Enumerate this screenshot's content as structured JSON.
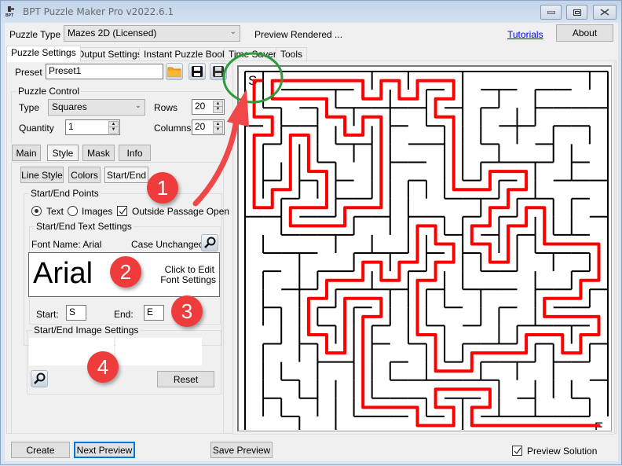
{
  "window": {
    "title": "BPT Puzzle Maker Pro v2022.6.1",
    "app_icon_text": "BPT",
    "controls": [
      "minimize",
      "maximize",
      "close"
    ]
  },
  "toolbar": {
    "puzzle_type_label": "Puzzle Type",
    "puzzle_type_value": "Mazes 2D (Licensed)",
    "status": "Preview Rendered ...",
    "tutorials_link": "Tutorials",
    "about_label": "About"
  },
  "tabs": [
    {
      "label": "Puzzle Settings",
      "active": true
    },
    {
      "label": "Output Settings",
      "active": false
    },
    {
      "label": "Instant Puzzle Books",
      "active": false
    },
    {
      "label": "Time Saver",
      "active": false
    },
    {
      "label": "Tools",
      "active": false
    }
  ],
  "preset": {
    "label": "Preset",
    "value": "Preset1",
    "icons": [
      "open-folder-icon",
      "save-icon",
      "save-as-icon"
    ]
  },
  "puzzle_control": {
    "title": "Puzzle Control",
    "type_label": "Type",
    "type_value": "Squares",
    "rows_label": "Rows",
    "rows_value": "20",
    "quantity_label": "Quantity",
    "quantity_value": "1",
    "columns_label": "Columns",
    "columns_value": "20"
  },
  "subtabs": [
    {
      "label": "Main",
      "active": false
    },
    {
      "label": "Style",
      "active": true
    },
    {
      "label": "Mask",
      "active": false
    },
    {
      "label": "Info",
      "active": false
    }
  ],
  "style_subtabs": [
    {
      "label": "Line Style",
      "active": false
    },
    {
      "label": "Colors",
      "active": false
    },
    {
      "label": "Start/End",
      "active": true
    }
  ],
  "start_end_points": {
    "title": "Start/End Points",
    "text_label": "Text",
    "text_selected": true,
    "images_label": "Images",
    "images_selected": false,
    "outside_passage_label": "Outside Passage Open",
    "outside_passage_checked": true
  },
  "text_settings": {
    "title": "Start/End Text Settings",
    "font_name": "Font Name: Arial",
    "case": "Case Unchanged",
    "preview_text": "Arial",
    "edit_hint_line1": "Click to Edit",
    "edit_hint_line2": "Font Settings",
    "start_label": "Start:",
    "start_value": "S",
    "end_label": "End:",
    "end_value": "E"
  },
  "image_settings": {
    "title": "Start/End Image Settings",
    "reset_label": "Reset"
  },
  "bottom": {
    "create_label": "Create",
    "next_preview_label": "Next Preview",
    "save_preview_label": "Save Preview",
    "preview_solution_label": "Preview Solution",
    "preview_solution_checked": true
  },
  "maze_preview": {
    "rows": 20,
    "columns": 20,
    "start_marker": "S",
    "end_marker": "E",
    "solution_color": "#ff0000",
    "wall_color": "#000000"
  },
  "annotations": {
    "badges": [
      "1",
      "2",
      "3",
      "4"
    ],
    "badge_color": "#ee3c3c",
    "arrow_color": "#f04848",
    "circle_color": "#2e9a3a"
  }
}
